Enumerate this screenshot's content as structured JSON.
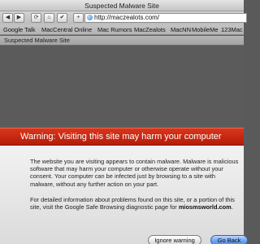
{
  "window": {
    "title": "Suspected Malware Site"
  },
  "toolbar": {
    "back_glyph": "◀",
    "forward_glyph": "▶",
    "reload_glyph": "⟳",
    "home_glyph": "⌂",
    "bookmark_glyph": "✔",
    "add_glyph": "+",
    "url": "http://maczealots.com/"
  },
  "bookmarks": [
    "Google Talk",
    "MacCentral Online",
    "Mac Rumors",
    "MacZealots",
    "MacNN",
    "MobileMe",
    "123Mac"
  ],
  "tab": {
    "label": "Suspected Malware Site"
  },
  "warning": {
    "title": "Warning: Visiting this site may harm your computer",
    "paragraph1": "The website you are visiting appears to contain malware. Malware is malicious software that may harm your computer or otherwise operate without your consent. Your computer can be infected just by browsing to a site with malware, without any further action on your part.",
    "paragraph2_text": "For detailed information about problems found on this site, or a portion of this site, visit the Google Safe Browsing diagnostic page for",
    "paragraph2_link": "miosmsworld.com",
    "paragraph2_end": "."
  },
  "buttons": {
    "ignore": "Ignore warning",
    "back": "Go Back"
  },
  "colors": {
    "banner": "#c62a12",
    "default_button": "#6ea3f3"
  }
}
